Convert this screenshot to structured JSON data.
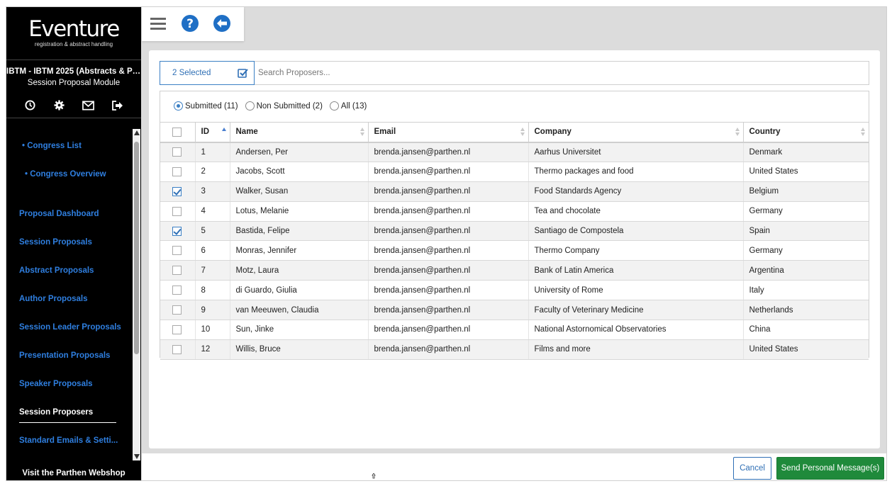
{
  "sidebar": {
    "logo_text": "Eventure",
    "logo_sub": "registration & abstract handling",
    "congress_title": "IBTM - IBTM 2025 (Abstracts & Par...",
    "module_title": "Session Proposal Module",
    "icons": [
      "clock-icon",
      "gear-icon",
      "mail-icon",
      "logout-icon"
    ],
    "nav": {
      "congress_list": "• Congress List",
      "congress_overview": "• Congress Overview",
      "proposal_dashboard": "Proposal Dashboard",
      "session_proposals": "Session Proposals",
      "abstract_proposals": "Abstract Proposals",
      "author_proposals": "Author Proposals",
      "session_leader_proposals": "Session Leader Proposals",
      "presentation_proposals": "Presentation Proposals",
      "speaker_proposals": "Speaker Proposals",
      "session_proposers": "Session Proposers",
      "standard_emails": "Standard Emails & Setti..."
    },
    "webshop": "Visit the Parthen Webshop"
  },
  "toolbar": {
    "icons": [
      "menu-icon",
      "help-icon",
      "back-arrow-icon"
    ]
  },
  "selection": {
    "label": "2 Selected"
  },
  "search": {
    "placeholder": "Search Proposers...",
    "value": ""
  },
  "filters": {
    "submitted": "Submitted (11)",
    "non_submitted": "Non Submitted (2)",
    "all": "All (13)",
    "selected": "submitted"
  },
  "table": {
    "headers": {
      "id": "ID",
      "name": "Name",
      "email": "Email",
      "company": "Company",
      "country": "Country"
    },
    "sort_column": "ID",
    "sort_direction": "asc",
    "rows": [
      {
        "checked": false,
        "id": "1",
        "name": "Andersen, Per",
        "email": "brenda.jansen@parthen.nl",
        "company": "Aarhus Universitet",
        "country": "Denmark"
      },
      {
        "checked": false,
        "id": "2",
        "name": "Jacobs, Scott",
        "email": "brenda.jansen@parthen.nl",
        "company": "Thermo packages and food",
        "country": "United States"
      },
      {
        "checked": true,
        "id": "3",
        "name": "Walker, Susan",
        "email": "brenda.jansen@parthen.nl",
        "company": "Food Standards Agency",
        "country": "Belgium"
      },
      {
        "checked": false,
        "id": "4",
        "name": "Lotus, Melanie",
        "email": "brenda.jansen@parthen.nl",
        "company": "Tea and chocolate",
        "country": "Germany"
      },
      {
        "checked": true,
        "id": "5",
        "name": "Bastida, Felipe",
        "email": "brenda.jansen@parthen.nl",
        "company": "Santiago de Compostela",
        "country": "Spain"
      },
      {
        "checked": false,
        "id": "6",
        "name": "Monras, Jennifer",
        "email": "brenda.jansen@parthen.nl",
        "company": "Thermo Company",
        "country": "Germany"
      },
      {
        "checked": false,
        "id": "7",
        "name": "Motz, Laura",
        "email": "brenda.jansen@parthen.nl",
        "company": "Bank of Latin America",
        "country": "Argentina"
      },
      {
        "checked": false,
        "id": "8",
        "name": "di Guardo, Giulia",
        "email": "brenda.jansen@parthen.nl",
        "company": "University of Rome",
        "country": "Italy"
      },
      {
        "checked": false,
        "id": "9",
        "name": "van Meeuwen, Claudia",
        "email": "brenda.jansen@parthen.nl",
        "company": "Faculty of Veterinary Medicine",
        "country": "Netherlands"
      },
      {
        "checked": false,
        "id": "10",
        "name": "Sun, Jinke",
        "email": "brenda.jansen@parthen.nl",
        "company": "National Astornomical Observatories",
        "country": "China"
      },
      {
        "checked": false,
        "id": "12",
        "name": "Willis, Bruce",
        "email": "brenda.jansen@parthen.nl",
        "company": "Films and more",
        "country": "United States"
      }
    ]
  },
  "footer": {
    "cancel_label": "Cancel",
    "send_label": "Send Personal Message(s)"
  },
  "colors": {
    "accent": "#2f6fb5",
    "nav_link": "#2f7fe0",
    "send_button": "#1f8a3b",
    "sidebar_bg": "#000000"
  }
}
